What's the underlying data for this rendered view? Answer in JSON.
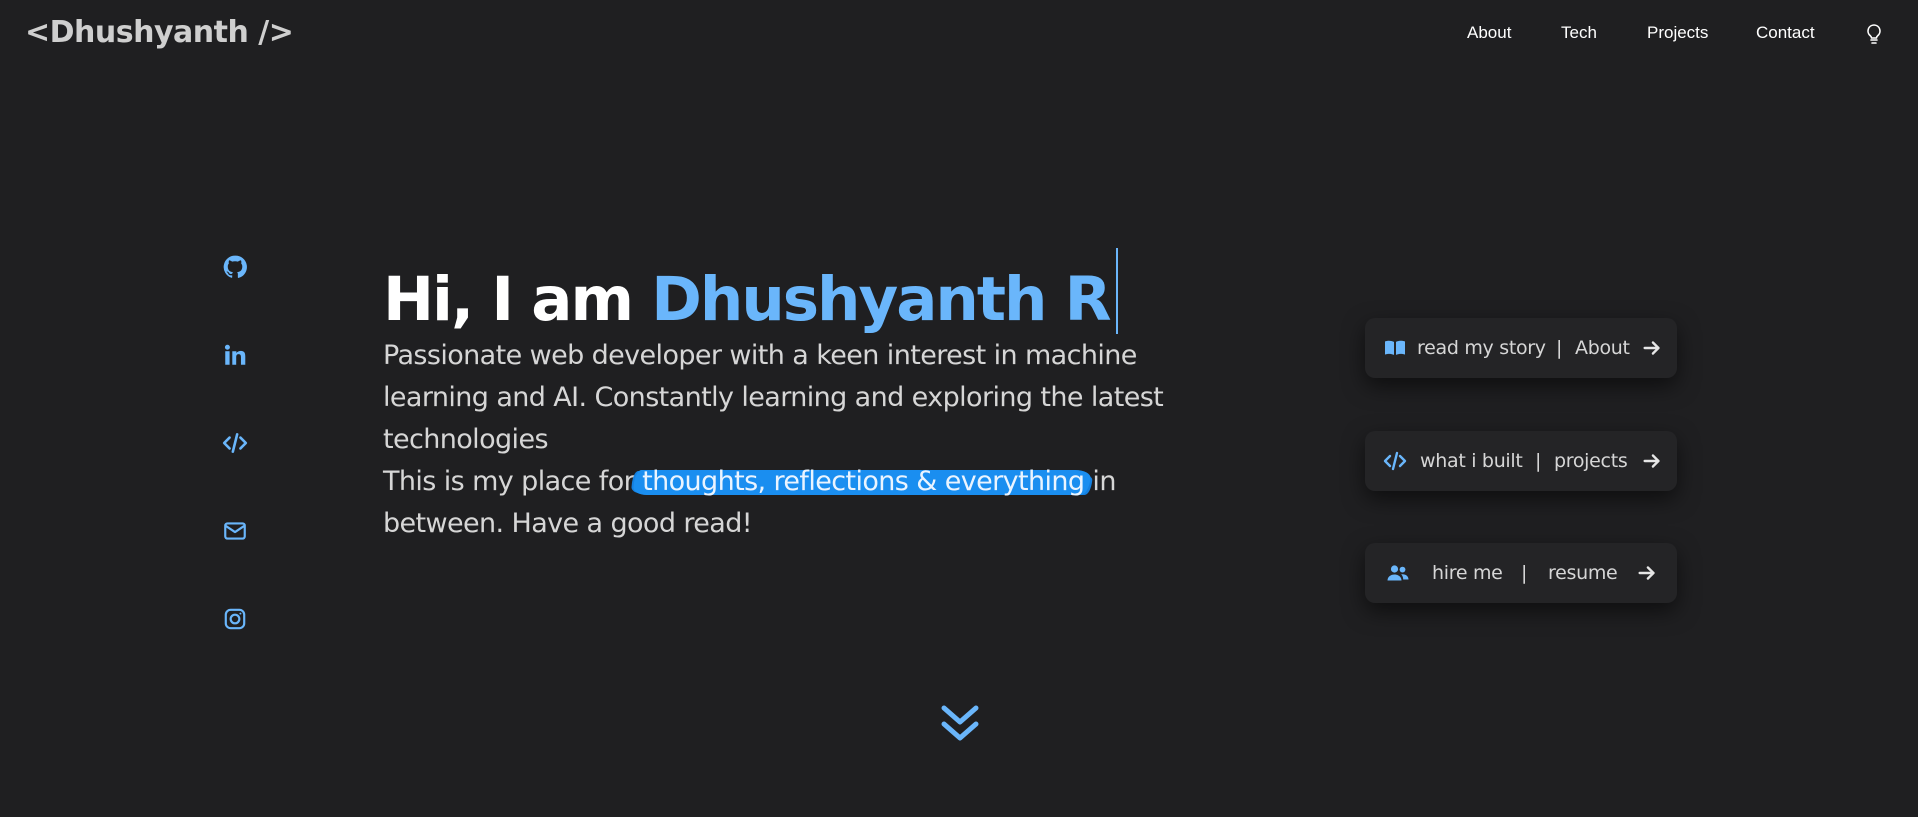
{
  "header": {
    "logo": "<Dhushyanth />",
    "nav": [
      {
        "label": "About"
      },
      {
        "label": "Tech"
      },
      {
        "label": "Projects"
      },
      {
        "label": "Contact"
      }
    ],
    "theme_icon": "lightbulb-icon"
  },
  "social": [
    {
      "icon": "github-icon"
    },
    {
      "icon": "linkedin-icon"
    },
    {
      "icon": "code-icon"
    },
    {
      "icon": "mail-icon"
    },
    {
      "icon": "instagram-icon"
    }
  ],
  "hero": {
    "greeting": "Hi, I am ",
    "name": "Dhushyanth R",
    "description": "Passionate web developer with a keen interest in machine learning and AI. Constantly learning and exploring the latest technologies",
    "line2_prefix": "This is my place for ",
    "line2_highlight": "thoughts, reflections & everything",
    "line2_suffix": " in between. Have a good read!"
  },
  "cards": [
    {
      "icon": "book-icon",
      "label": "read my story",
      "separator": "|",
      "target": "About",
      "arrow": "arrow-right-icon"
    },
    {
      "icon": "code-icon",
      "label": "what i built",
      "separator": "|",
      "target": "projects",
      "arrow": "arrow-right-icon"
    },
    {
      "icon": "users-icon",
      "label": "hire me",
      "separator": "|",
      "target": "resume",
      "arrow": "arrow-right-icon"
    }
  ],
  "scroll": {
    "icon": "double-chevron-down-icon"
  },
  "colors": {
    "background": "#1f1f21",
    "accent": "#6ab6fb",
    "highlight": "#1a8ef0",
    "card": "#242426"
  }
}
